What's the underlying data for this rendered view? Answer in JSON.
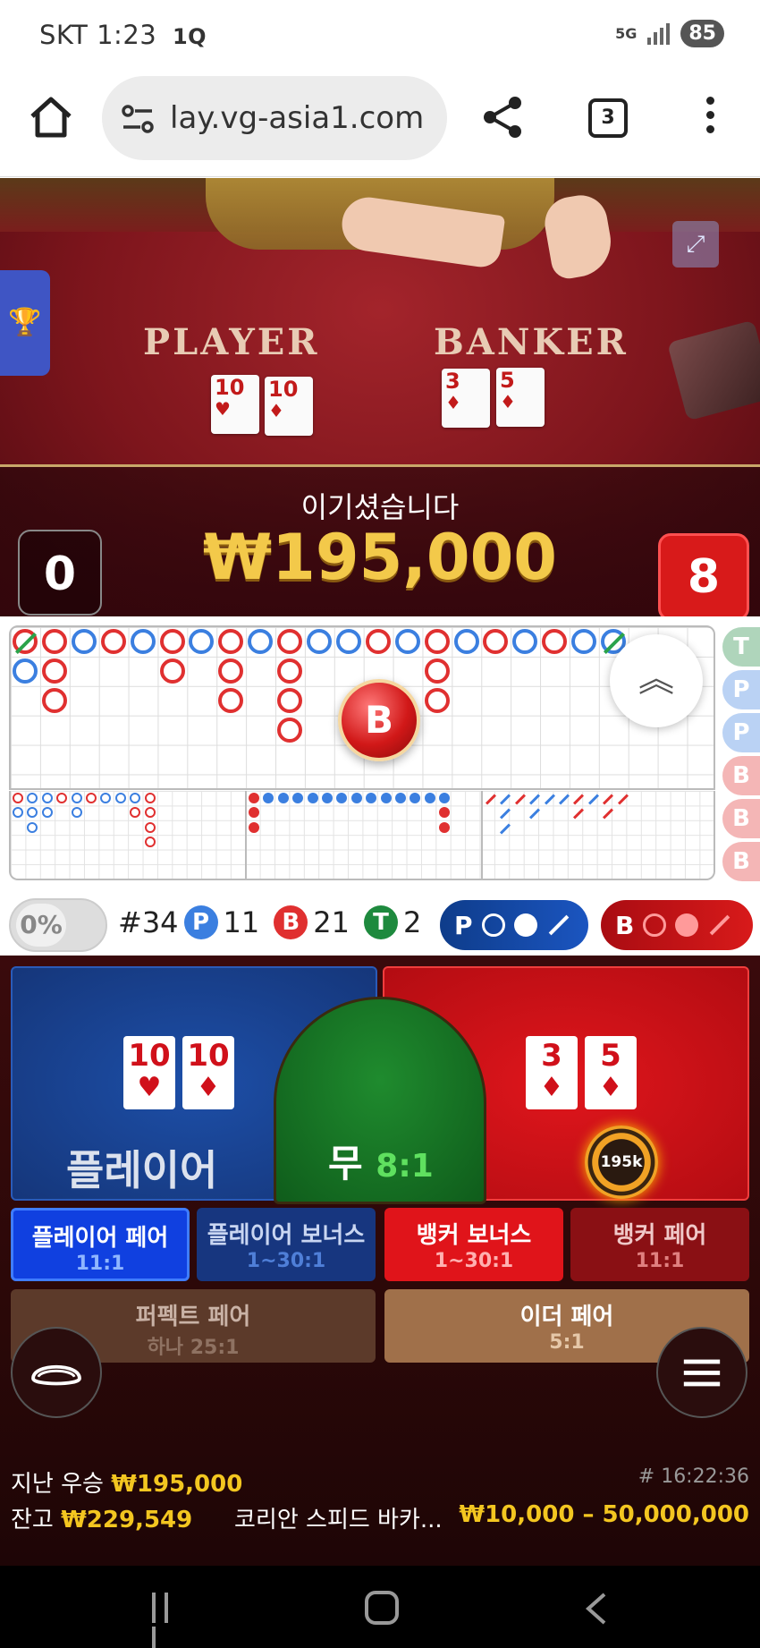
{
  "status_bar": {
    "carrier": "SKT",
    "time": "1:23",
    "extra": "1Q",
    "network": "5G",
    "battery": "85"
  },
  "browser": {
    "url": "lay.vg-asia1.com",
    "tab_count": "3"
  },
  "table": {
    "player_label": "PLAYER",
    "banker_label": "BANKER",
    "player_cards": [
      {
        "rank": "10",
        "suit": "♥"
      },
      {
        "rank": "10",
        "suit": "♦"
      }
    ],
    "banker_cards": [
      {
        "rank": "3",
        "suit": "♦"
      },
      {
        "rank": "5",
        "suit": "♦"
      }
    ]
  },
  "result": {
    "message": "이기셨습니다",
    "amount": "₩195,000",
    "player_score": "0",
    "banker_score": "8"
  },
  "roadmap": {
    "center_badge": "B",
    "side_column": [
      "T",
      "P",
      "P",
      "B",
      "B",
      "B"
    ],
    "big_road": [
      [
        "B-tie",
        "P"
      ],
      [
        "B",
        "B",
        "B"
      ],
      [
        "P"
      ],
      [
        "B"
      ],
      [
        "P"
      ],
      [
        "B",
        "B"
      ],
      [
        "P"
      ],
      [
        "B",
        "B",
        "B"
      ],
      [
        "P"
      ],
      [
        "B",
        "B",
        "B",
        "B"
      ],
      [
        "P"
      ],
      [
        "P"
      ],
      [
        "B"
      ],
      [
        "P"
      ],
      [
        "B",
        "B",
        "B"
      ],
      [
        "P"
      ],
      [
        "B"
      ],
      [
        "P"
      ],
      [
        "B"
      ],
      [
        "P"
      ],
      [
        "P-tie"
      ]
    ]
  },
  "stats": {
    "percent": "0%",
    "round": "#34",
    "p_label": "P",
    "p_count": "11",
    "b_label": "B",
    "b_count": "21",
    "t_label": "T",
    "t_count": "2",
    "predict_p": "P",
    "predict_b": "B"
  },
  "betting": {
    "player_label": "플레이어",
    "tie_label": "무",
    "tie_odds": "8:1",
    "chip_label": "195k",
    "side_bets": [
      {
        "title": "플레이어 페어",
        "odds": "11:1"
      },
      {
        "title": "플레이어 보너스",
        "odds": "1~30:1"
      },
      {
        "title": "뱅커 보너스",
        "odds": "1~30:1"
      },
      {
        "title": "뱅커 페어",
        "odds": "11:1"
      }
    ],
    "wide_bets": [
      {
        "title": "퍼펙트 페어",
        "odds": "하나 25:1"
      },
      {
        "title": "이더 페어",
        "odds": "5:1"
      }
    ]
  },
  "footer": {
    "last_win_label": "지난 우승",
    "last_win_amount": "₩195,000",
    "round_id": "# 16:22:36",
    "balance_label": "잔고",
    "balance_amount": "₩229,549",
    "table_name": "코리안 스피드 바카...",
    "limits": "₩10,000 – 50,000,000"
  },
  "colors": {
    "player_blue": "#1d4fa8",
    "banker_red": "#d81a1a",
    "tie_green": "#1f8b2e",
    "gold": "#f3c94a"
  }
}
